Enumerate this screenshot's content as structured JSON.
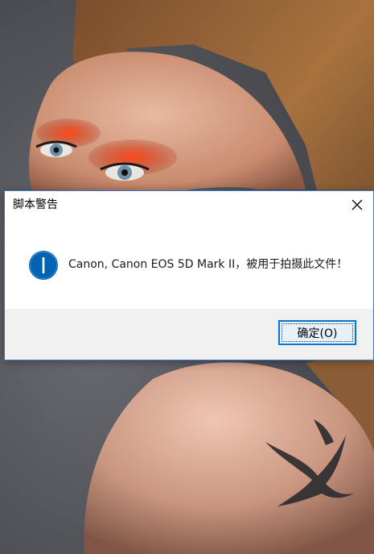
{
  "dialog": {
    "title": "脚本警告",
    "message": "Canon, Canon EOS 5D Mark II，被用于拍摄此文件！",
    "ok_label": "确定(O)",
    "icon": "info-icon",
    "close_icon": "close-icon"
  },
  "colors": {
    "accent": "#0078d7",
    "border": "#3b78c4",
    "footer_bg": "#f0f0f0",
    "icon_blue": "#0063b1"
  }
}
